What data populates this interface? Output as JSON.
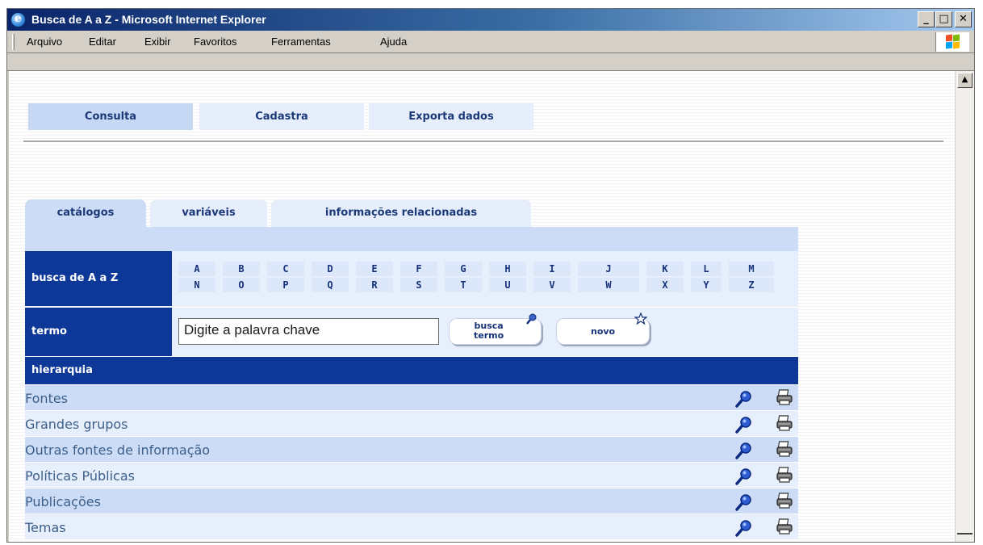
{
  "window": {
    "title": "Busca de A a Z - Microsoft Internet Explorer",
    "min_label": "_",
    "max_label": "□",
    "close_label": "✕"
  },
  "menu": {
    "items": [
      "Arquivo",
      "Editar",
      "Exibir",
      "Favoritos",
      "Ferramentas",
      "Ajuda"
    ]
  },
  "top_tabs": [
    {
      "label": "Consulta",
      "active": true
    },
    {
      "label": "Cadastra",
      "active": false
    },
    {
      "label": "Exporta dados",
      "active": false
    }
  ],
  "sub_tabs": [
    {
      "label": "catálogos",
      "active": true
    },
    {
      "label": "variáveis",
      "active": false
    },
    {
      "label": "informações relacionadas",
      "active": false
    }
  ],
  "az": {
    "label": "busca de A a Z",
    "row1": [
      "A",
      "B",
      "C",
      "D",
      "E",
      "F",
      "G",
      "H",
      "I",
      "J",
      "K",
      "L",
      "M"
    ],
    "row2": [
      "N",
      "O",
      "P",
      "Q",
      "R",
      "S",
      "T",
      "U",
      "V",
      "W",
      "X",
      "Y",
      "Z"
    ]
  },
  "term": {
    "label": "termo",
    "input_value": "Digite a palavra chave",
    "search_button_line1": "busca",
    "search_button_line2": "termo",
    "new_button": "novo"
  },
  "hierarchy": {
    "header": "hierarquia",
    "items": [
      "Fontes",
      "Grandes grupos",
      "Outras fontes de informação",
      "Políticas Públicas",
      "Publicações",
      "Temas"
    ],
    "icons": {
      "search": "magnifier-icon",
      "print": "printer-icon"
    }
  },
  "colors": {
    "header_blue": "#0d3897",
    "row_odd": "#cddcf6",
    "row_even": "#e8effc",
    "link_text": "#3b5f8a"
  }
}
